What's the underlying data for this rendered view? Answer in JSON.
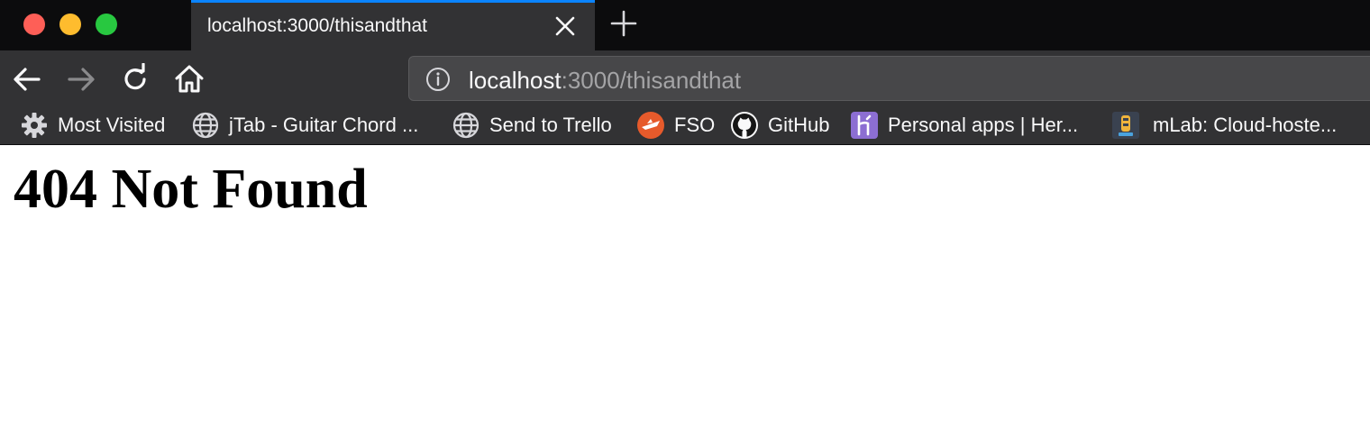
{
  "tab": {
    "title": "localhost:3000/thisandthat"
  },
  "address_bar": {
    "host": "localhost",
    "path": ":3000/thisandthat"
  },
  "bookmarks": [
    {
      "label": "Most Visited",
      "icon": "gear-icon"
    },
    {
      "label": "jTab - Guitar Chord ...",
      "icon": "globe-icon"
    },
    {
      "label": "Send to Trello",
      "icon": "globe-icon"
    },
    {
      "label": "FSO",
      "icon": "fso-icon"
    },
    {
      "label": "GitHub",
      "icon": "github-icon"
    },
    {
      "label": "Personal apps | Her...",
      "icon": "heroku-icon"
    },
    {
      "label": "mLab: Cloud-hoste...",
      "icon": "mlab-icon"
    }
  ],
  "page": {
    "heading": "404 Not Found"
  },
  "colors": {
    "tab_accent": "#0a84ff",
    "chrome_dark": "#0c0c0d",
    "toolbar": "#323234",
    "close_red": "#fe5f57",
    "minimize_yellow": "#febc2e",
    "maximize_green": "#28c840"
  }
}
